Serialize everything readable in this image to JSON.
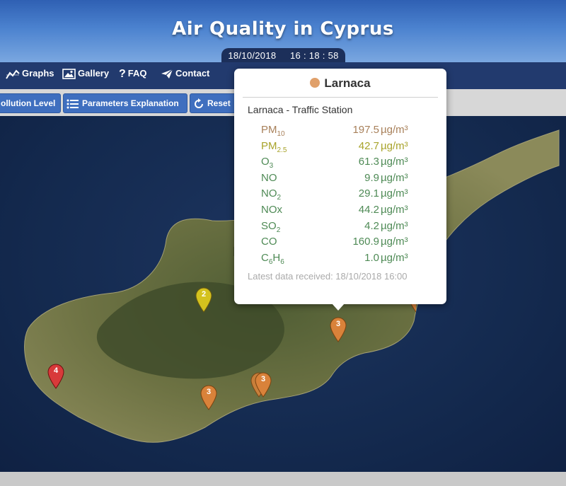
{
  "header": {
    "title": "Air Quality in Cyprus",
    "date": "18/10/2018",
    "time": "16 : 18 : 58"
  },
  "nav": {
    "items": [
      {
        "label": "Graphs",
        "icon": "chart-line-icon"
      },
      {
        "label": "Gallery",
        "icon": "image-icon"
      },
      {
        "label": "FAQ",
        "icon": "question-icon"
      },
      {
        "label": "Contact",
        "icon": "paper-plane-icon"
      }
    ]
  },
  "toolbar": {
    "pollution_level": "ollution Level",
    "parameters_explanation": "Parameters Explanation",
    "reset": "Reset"
  },
  "popup": {
    "city": "Larnaca",
    "city_color": "#e0a06a",
    "station": "Larnaca - Traffic Station",
    "rows": [
      {
        "name": "PM",
        "sub": "10",
        "value": "197.5",
        "unit": "µg/m³",
        "color": "#a8805a"
      },
      {
        "name": "PM",
        "sub": "2.5",
        "value": "42.7",
        "unit": "µg/m³",
        "color": "#a8a32a"
      },
      {
        "name": "O",
        "sub": "3",
        "value": "61.3",
        "unit": "µg/m³",
        "color": "#4e8a55"
      },
      {
        "name": "NO",
        "sub": "",
        "value": "9.9",
        "unit": "µg/m³",
        "color": "#4e8a55"
      },
      {
        "name": "NO",
        "sub": "2",
        "value": "29.1",
        "unit": "µg/m³",
        "color": "#4e8a55"
      },
      {
        "name": "NOx",
        "sub": "",
        "value": "44.2",
        "unit": "µg/m³",
        "color": "#4e8a55"
      },
      {
        "name": "SO",
        "sub": "2",
        "value": "4.2",
        "unit": "µg/m³",
        "color": "#4e8a55"
      },
      {
        "name": "CO",
        "sub": "",
        "value": "160.9",
        "unit": "µg/m³",
        "color": "#4e8a55"
      },
      {
        "name": "C",
        "sub": "6",
        "name2": "H",
        "sub2": "6",
        "value": "1.0",
        "unit": "µg/m³",
        "color": "#4e8a55"
      }
    ],
    "latest": "Latest data received: 18/10/2018 16:00"
  },
  "markers": [
    {
      "label": "2",
      "color": "#d4c21e"
    },
    {
      "label": "3",
      "color": "#d9823a"
    },
    {
      "label": "4",
      "color": "#d83a3a"
    },
    {
      "label": "3",
      "color": "#d9823a"
    },
    {
      "label": "3",
      "color": "#d9823a"
    }
  ],
  "colors": {
    "header": "#3d70c2",
    "nav": "#223a6e",
    "button": "#3f6fbf"
  }
}
